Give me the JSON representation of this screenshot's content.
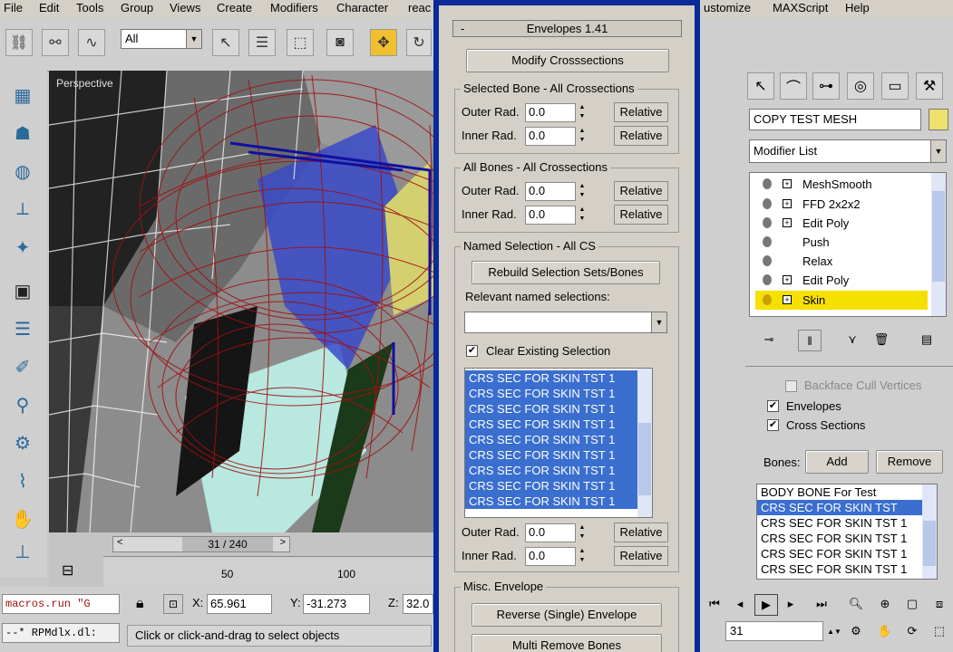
{
  "menubar": {
    "items": [
      "File",
      "Edit",
      "Tools",
      "Group",
      "Views",
      "Create",
      "Modifiers",
      "Character",
      "reac"
    ],
    "right_items": [
      "ustomize",
      "MAXScript",
      "Help"
    ]
  },
  "toolbar": {
    "selection_filter": "All",
    "icons": [
      "select-link-icon",
      "unlink-icon",
      "bind-spacewarp-icon",
      "select-icon",
      "select-by-name-icon",
      "rect-region-icon",
      "window-crossing-icon",
      "move-icon",
      "rotate-icon"
    ],
    "right_icons": [
      "angle-snap-icon",
      "percent-snap-icon",
      "spinner-snap-icon",
      "edit-named-sel-icon"
    ]
  },
  "viewport": {
    "label": "Perspective"
  },
  "timeline": {
    "frame": "31 / 240",
    "ticks": [
      "50",
      "100"
    ]
  },
  "status": {
    "script_line1": "macros.run \"G",
    "script_line2": "--* RPMdlx.dl:",
    "x_label": "X:",
    "x_value": "65.961",
    "y_label": "Y:",
    "y_value": "-31.273",
    "z_label": "Z:",
    "z_value": "32.0",
    "prompt": "Click or click-and-drag to select objects"
  },
  "envelopes": {
    "title": "Envelopes 1.41",
    "modify_btn": "Modify Crosssections",
    "selected_bone_group": "Selected Bone - All Crossections",
    "all_bones_group": "All Bones - All Crossections",
    "outer_rad": "Outer Rad.",
    "inner_rad": "Inner Rad.",
    "spin_value": "0.0",
    "relative": "Relative",
    "named_sel_group": "Named Selection - All CS",
    "rebuild_btn": "Rebuild Selection Sets/Bones",
    "relevant_label": "Relevant named selections:",
    "clear_existing": "Clear Existing Selection",
    "crs_items": [
      "CRS SEC FOR SKIN TST 1",
      "CRS SEC FOR SKIN TST 1",
      "CRS SEC FOR SKIN TST 1",
      "CRS SEC FOR SKIN TST 1",
      "CRS SEC FOR SKIN TST 1",
      "CRS SEC FOR SKIN TST 1",
      "CRS SEC FOR SKIN TST 1",
      "CRS SEC FOR SKIN TST 1",
      "CRS SEC FOR SKIN TST 1"
    ],
    "misc_group": "Misc. Envelope",
    "reverse_btn": "Reverse (Single) Envelope",
    "multi_remove_btn": "Multi Remove Bones"
  },
  "command_panel": {
    "object_name": "COPY TEST MESH",
    "object_color": "#f0e070",
    "modifier_list": "Modifier List",
    "stack": [
      {
        "label": "MeshSmooth",
        "expand": true,
        "selected": false
      },
      {
        "label": "FFD 2x2x2",
        "expand": true,
        "selected": false
      },
      {
        "label": "Edit Poly",
        "expand": true,
        "selected": false
      },
      {
        "label": "Push",
        "expand": false,
        "selected": false
      },
      {
        "label": "Relax",
        "expand": false,
        "selected": false
      },
      {
        "label": "Edit Poly",
        "expand": true,
        "selected": false
      },
      {
        "label": "Skin",
        "expand": true,
        "selected": true
      }
    ],
    "backface": "Backface Cull Vertices",
    "envelopes_chk": "Envelopes",
    "cross_sections_chk": "Cross Sections",
    "bones_label": "Bones:",
    "add_btn": "Add",
    "remove_btn": "Remove",
    "bones_list": [
      "BODY BONE For Test",
      "CRS SEC FOR SKIN TST",
      "CRS SEC FOR SKIN TST 1",
      "CRS SEC FOR SKIN TST 1",
      "CRS SEC FOR SKIN TST 1",
      "CRS SEC FOR SKIN TST 1"
    ],
    "frame_field": "31"
  }
}
